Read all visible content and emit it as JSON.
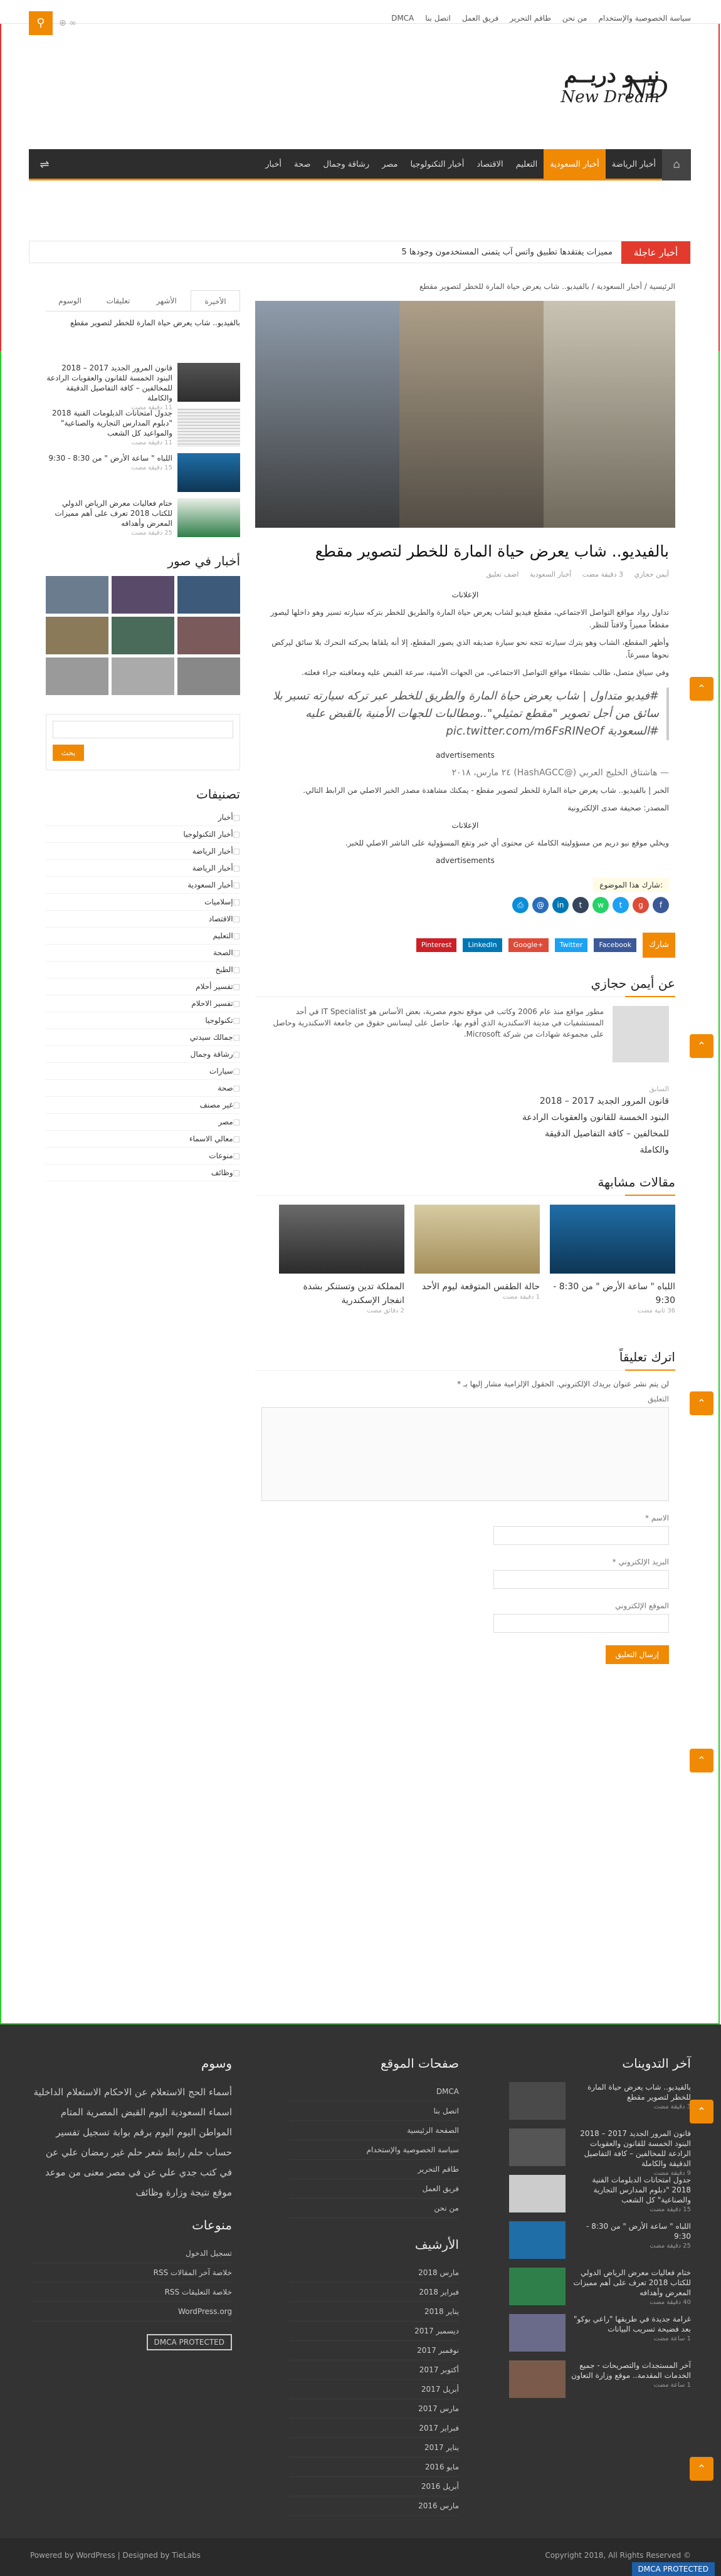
{
  "top_links": [
    "سياسة الخصوصية والإستخدام",
    "من نحن",
    "طاقم التحرير",
    "فريق العمل",
    "اتصل بنا",
    "DMCA"
  ],
  "logo": {
    "arabic": "نيــو دريــم",
    "english": "New Dream",
    "mark": "ND"
  },
  "nav": {
    "items": [
      "أخبار الرياضة",
      "أخبار السعودية",
      "التعليم",
      "الاقتصاد",
      "أخبار التكنولوجيا",
      "مصر",
      "رشاقة وجمال",
      "صحة",
      "أخبار"
    ],
    "active_index": 1
  },
  "breaking": {
    "label": "أخبار عاجلة",
    "text": "5 مميزات يفتقدها تطبيق واتس آب يتمنى المستخدمون وجودها"
  },
  "breadcrumb": "الرئيسية / أخبار السعودية / بالفيديو.. شاب يعرض حياة المارة للخطر لتصوير مقطع",
  "post": {
    "title": "بالفيديو.. شاب يعرض حياة المارة للخطر لتصوير مقطع",
    "author": "أيمن حجازي",
    "time": "3 دقيقة مضت",
    "category": "أخبار السعودية",
    "comment": "اضف تعليق",
    "ads_label": "الإعلانات",
    "p1": "تداول رواد مواقع التواصل الاجتماعي، مقطع فيديو لشاب يعرض حياة المارة والطريق للخطر بتركه سيارته تسير وهو داخلها ليصور مقطعاً مميزاً ولافتاً للنظر.",
    "p2": "وأظهر المقطع، الشاب وهو يترك سيارته تتجه نحو سيارة صديقه الذي يصور المقطع، إلا أنه يلقاها بحركته النحرك بلا سائق ليركض نحوها مسرعاً.",
    "p3": "وفي سياق متصل، طالب نشطاء مواقع التواصل الاجتماعي، من الجهات الأمنية، سرعة القبض عليه ومعاقبته جراء فعلته.",
    "quote": "#فيديو متداول | شاب يعرض حياة المارة والطريق للخطر عبر تركه سيارته تسير بلا سائق من أجل تصوير \"مقطع تمثيلي\"..ومطالبات للجهات الأمنية بالقبض عليه #السعودية pic.twitter.com/m6FsRINeOf",
    "quote_source": "— هاشتاق الخليج العربي (@HashAGCC) ٢٤ مارس، ٢٠١٨",
    "advertisements": "advertisements",
    "p4": "الخبر | بالفيديو.. شاب يعرض حياة المارة للخطر لتصوير مقطع - يمكنك مشاهدة مصدر الخبر الاصلي من الرابط التالي.",
    "p5": "المصدر: صحيفة صدى الإلكترونية",
    "p6": "ويخلي موقع نيو دريم من مسؤوليته الكاملة عن محتوى أي خبر وتقع المسؤولية على الناشر الاصلي للخبر."
  },
  "share": {
    "tag": "شارك هذا الموضوع:",
    "share_label": "شارك",
    "buttons": [
      "Facebook",
      "Twitter",
      "Google+",
      "LinkedIn",
      "Pinterest"
    ]
  },
  "author_box": {
    "heading": "عن أيمن حجازي",
    "bio": "مطور مواقع منذ عام 2006 وكاتب في موقع نجوم مصرية، بعض الأساس هو IT Specialist في أحد المستشفيات في مدينة الاسكندرية الذي أقوم بها، حاصل على ليسانس حقوق من جامعة الاسكندرية وحاصل على مجموعة شهادات من شركة Microsoft."
  },
  "prev_post": {
    "label": "السابق",
    "title": "قانون المرور الجديد 2017 – 2018 البنود الخمسة للقانون والعقوبات الرادعة للمخالفين – كافة التفاصيل الدقيقة والكاملة"
  },
  "related": {
    "heading": "مقالات مشابهة",
    "items": [
      {
        "title": "اللباه \" ساعة الأرض \" من 8:30 - 9:30",
        "time": "36 ثانية مضت"
      },
      {
        "title": "حالة الطقس المتوقعة ليوم الأحد",
        "time": "1 دقيقة مضت"
      },
      {
        "title": "المملكة تدين وتستنكر بشدة انفجار الإسكندرية",
        "time": "2 دقائق مضت"
      }
    ]
  },
  "comment_form": {
    "heading": "اترك تعليقاً",
    "note": "لن يتم نشر عنوان بريدك الإلكتروني. الحقول الإلزامية مشار إليها بـ *",
    "comment_label": "التعليق",
    "name_label": "الاسم *",
    "email_label": "البريد الإلكتروني *",
    "site_label": "الموقع الإلكتروني",
    "submit": "إرسال التعليق"
  },
  "sidebar": {
    "tabs": [
      "الأخيرة",
      "الأشهر",
      "تعليقات",
      "الوسوم"
    ],
    "posts": [
      {
        "title": "بالفيديو.. شاب يعرض حياة المارة للخطر لتصوير مقطع",
        "time": ""
      },
      {
        "title": "قانون المرور الجديد 2017 – 2018 البنود الخمسة للقانون والعقوبات الرادعة للمخالفين – كافة التفاصيل الدقيقة والكاملة",
        "time": "11 دقيقة مضت"
      },
      {
        "title": "جدول امتحانات الدبلومات الفنية 2018 \"دبلوم المدارس التجارية والصناعية\" والمواعيد كل الشعب",
        "time": "11 دقيقة مضت"
      },
      {
        "title": "اللباه \" ساعة الأرض \" من 8:30 - 9:30",
        "time": "15 دقيقة مضت"
      },
      {
        "title": "ختام فعاليات معرض الرياض الدولي للكتاب 2018 تعرف على أهم مميزات المعرض وأهدافه",
        "time": "25 دقيقة مضت"
      }
    ],
    "photos_heading": "أخبار في صور",
    "search_button": "بحث",
    "categories_heading": "تصنيفات",
    "categories": [
      "أخبار",
      "أخبار التكنولوجيا",
      "أخبار الرياضة",
      "أخبار الرياضة",
      "أخبار السعودية",
      "إسلاميات",
      "الاقتصاد",
      "التعليم",
      "الصحة",
      "الطبخ",
      "تفسير أحلام",
      "تفسير الاحلام",
      "تكنولوجيا",
      "جمالك سيدتي",
      "رشاقة وجمال",
      "سيارات",
      "صحة",
      "غير مصنف",
      "مصر",
      "معالي الاسماء",
      "منوعات",
      "وظائف"
    ]
  },
  "footer": {
    "latest_heading": "آخر التدوينات",
    "latest": [
      {
        "title": "بالفيديو.. شاب يعرض حياة المارة للخطر لتصوير مقطع",
        "time": "3 دقيقة مضت"
      },
      {
        "title": "قانون المرور الجديد 2017 – 2018 البنود الخمسة للقانون والعقوبات الرادعة للمخالفين – كافة التفاصيل الدقيقة والكاملة",
        "time": "9 دقيقة مضت"
      },
      {
        "title": "جدول امتحانات الدبلومات الفنية 2018 \"دبلوم المدارس التجارية والصناعية\" كل الشعب",
        "time": "15 دقيقة مضت"
      },
      {
        "title": "اللباه \" ساعة الأرض \" من 8:30 - 9:30",
        "time": "25 دقيقة مضت"
      },
      {
        "title": "ختام فعاليات معرض الرياض الدولي للكتاب 2018 تعرف على أهم مميزات المعرض وأهدافه",
        "time": "40 دقيقة مضت"
      },
      {
        "title": "غرامة جديدة في طريقها \"راعي بوكو\" بعد فضيحة تسريب البيانات",
        "time": "1 ساعة مضت"
      },
      {
        "title": "آخر المستجدات والتصريحات - جميع الخدمات المقدمة.. موقع وزارة التعاون",
        "time": "1 ساعة مضت"
      }
    ],
    "pages_heading": "صفحات الموقع",
    "pages": [
      "DMCA",
      "اتصل بنا",
      "الصفحة الرئيسية",
      "سياسة الخصوصية والإستخدام",
      "طاقم التحرير",
      "فريق العمل",
      "من نحن"
    ],
    "archive_heading": "الأرشيف",
    "archive": [
      "مارس 2018",
      "فبراير 2018",
      "يناير 2018",
      "ديسمبر 2017",
      "نوفمبر 2017",
      "أكتوبر 2017",
      "أبريل 2017",
      "مارس 2017",
      "فبراير 2017",
      "يناير 2017",
      "مايو 2016",
      "أبريل 2016",
      "مارس 2016"
    ],
    "tags_heading": "وسوم",
    "tags": "أسماء الحج الاستعلام عن الاحكام الاستعلام الداخلية اسماء السعودية اليوم القبض المصرية المتام المواطن اليوم اليوم برقم بوابة تسجيل تفسير حساب حلم رابط شعر حلم غير رمضان علي عن في كتب جدي علي عن في مصر معنى من موعد موقع نتيجة وزارة وظائف",
    "misc_heading": "منوعات",
    "misc": [
      "تسجيل الدخول",
      "خلاصة آخر المقالات RSS",
      "خلاصة التعليقات RSS",
      "WordPress.org"
    ],
    "dmca": "DMCA PROTECTED"
  },
  "bottom": {
    "copyright": "Copyright 2018, All Rights Reserved ©",
    "powered": "Powered by WordPress | Designed by TieLabs",
    "dmca": "DMCA PROTECTED"
  }
}
